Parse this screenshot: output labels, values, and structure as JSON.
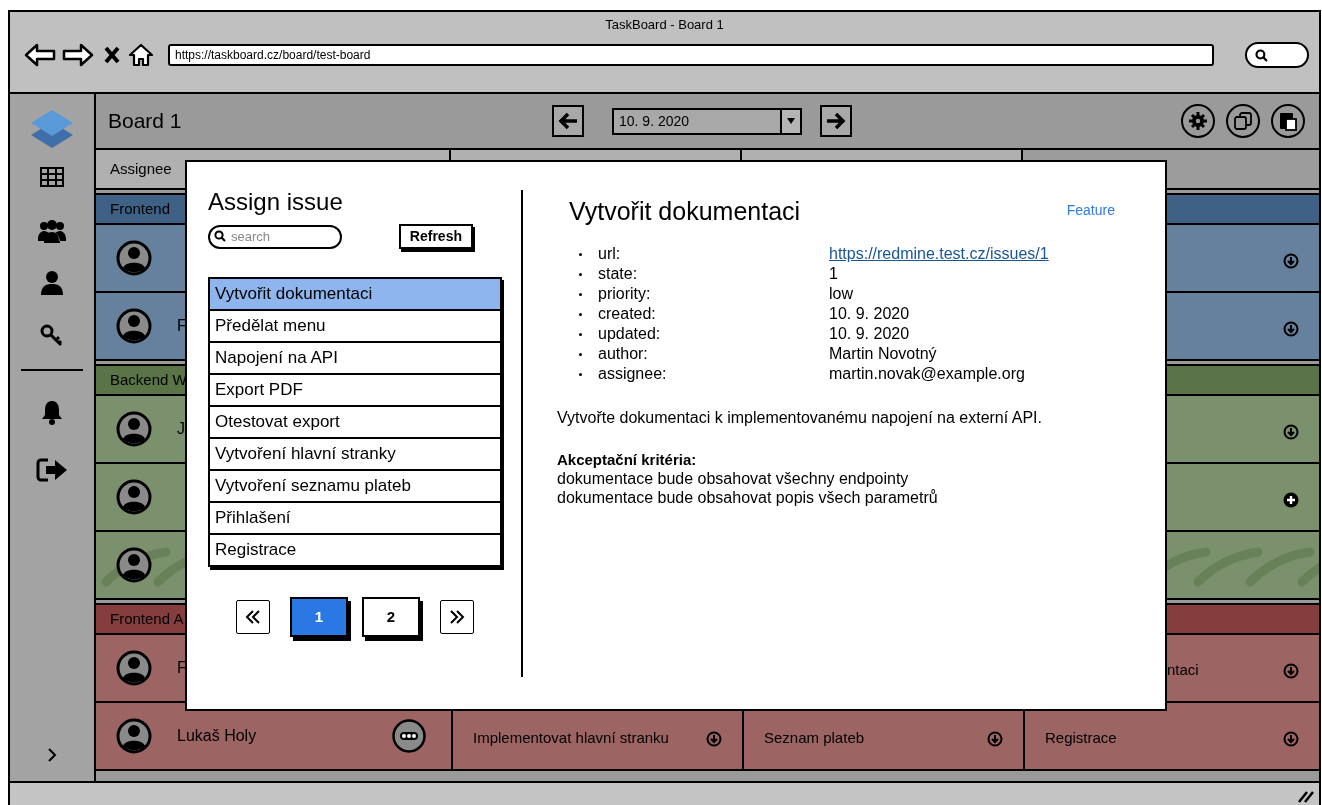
{
  "window": {
    "title": "TaskBoard - Board 1",
    "url": "https://taskboard.cz/board/test-board"
  },
  "board": {
    "title": "Board 1",
    "date": "10. 9. 2020",
    "assignee_header": "Assignee",
    "groups": [
      {
        "name": "Frontend",
        "color": "#3f6185",
        "rows": [
          {
            "column_4": {
              "kind": "down"
            }
          },
          {
            "assignee": "F",
            "column_4": {
              "kind": "down"
            }
          }
        ]
      },
      {
        "name": "Backend W",
        "color": "#5a7447",
        "rows": [
          {
            "assignee": "J",
            "column_4": {
              "kind": "down"
            }
          },
          {
            "column_4": {
              "kind": "plus"
            }
          },
          {
            "hatched": true
          }
        ]
      },
      {
        "name": "Frontend A",
        "color": "#853d3d",
        "rows": [
          {
            "assignee": "F",
            "column_4": {
              "text": "ntaci",
              "kind": "down"
            }
          },
          {
            "assignee": "Lukaš Holy",
            "menu": true,
            "column_2": {
              "text": "Implementovat hlavní stranku",
              "kind": "down"
            },
            "column_3": {
              "text": "Seznam plateb",
              "kind": "down"
            },
            "column_4": {
              "text": "Registrace",
              "kind": "down"
            }
          }
        ]
      }
    ]
  },
  "assign_dialog": {
    "title": "Assign issue",
    "search": {
      "placeholder": "search"
    },
    "refresh_button": "Refresh",
    "issues": [
      {
        "label": "Vytvořit dokumentaci",
        "selected": true
      },
      {
        "label": "Předělat menu",
        "selected": false
      },
      {
        "label": "Napojení na API",
        "selected": false
      },
      {
        "label": "Export PDF",
        "selected": false
      },
      {
        "label": "Otestovat export",
        "selected": false
      },
      {
        "label": "Vytvoření hlavní stranky",
        "selected": false
      },
      {
        "label": "Vytvoření seznamu plateb",
        "selected": false
      },
      {
        "label": "Přihlašení",
        "selected": false
      },
      {
        "label": "Registrace",
        "selected": false
      }
    ],
    "pages": [
      {
        "label": "1",
        "selected": true
      },
      {
        "label": "2",
        "selected": false
      }
    ]
  },
  "issue_detail": {
    "title": "Vytvořit dokumentaci",
    "type": "Feature",
    "properties": [
      {
        "label": "url:",
        "value": "https://redmine.test.cz/issues/1",
        "kind": "link"
      },
      {
        "label": "state:",
        "value": "1",
        "kind": "text"
      },
      {
        "label": "priority:",
        "value": "low",
        "kind": "text"
      },
      {
        "label": "created:",
        "value": "10. 9. 2020",
        "kind": "text"
      },
      {
        "label": "updated:",
        "value": "10. 9. 2020",
        "kind": "text"
      },
      {
        "label": "author:",
        "value": "Martin Novotný",
        "kind": "text"
      },
      {
        "label": "assignee:",
        "value": "martin.novak@example.org",
        "kind": "text"
      }
    ],
    "description": "Vytvořte dokumentaci k implementovanému napojení na externí API.",
    "acceptance_title": "Akceptační kritéria:",
    "acceptance": [
      "dokumentace bude obsahovat všechny endpointy",
      "dokumentace bude obsahovat popis všech parametrů"
    ]
  }
}
